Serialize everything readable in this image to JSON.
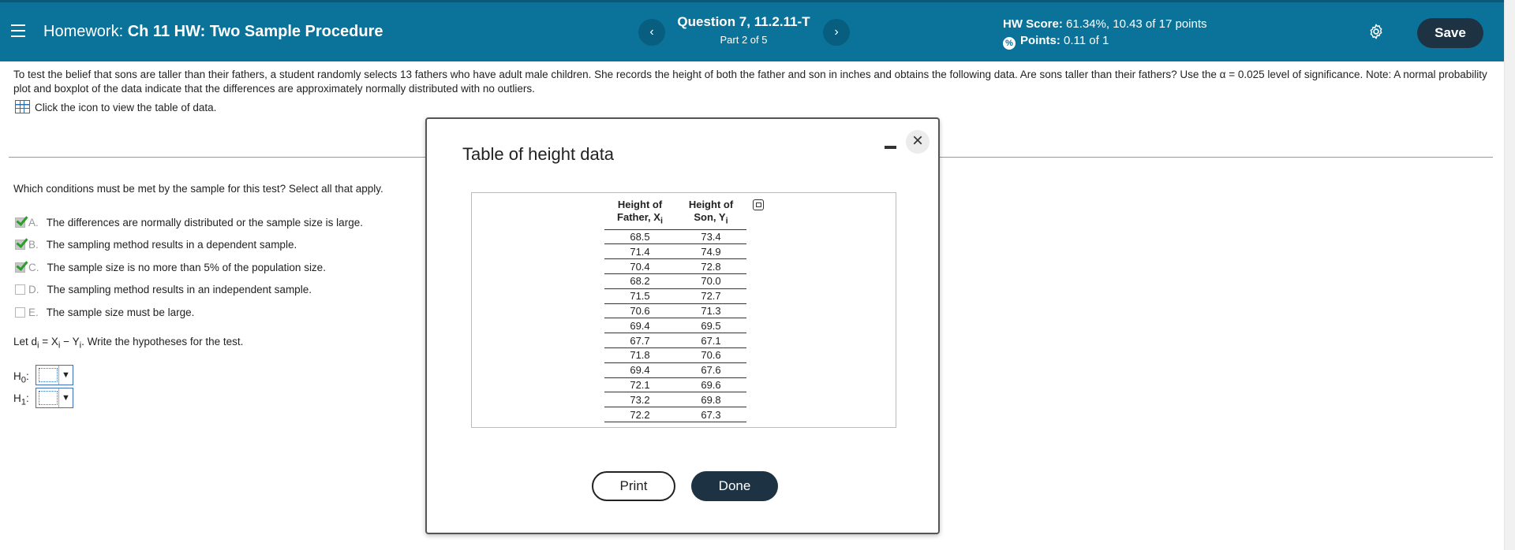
{
  "header": {
    "title_prefix": "Homework:",
    "title": "Ch 11 HW: Two Sample Procedure",
    "question_title": "Question 7, 11.2.11-T",
    "question_part": "Part 2 of 5",
    "prev_label": "‹",
    "next_label": "›",
    "hw_score_label": "HW Score:",
    "hw_score_value": "61.34%, 10.43 of 17 points",
    "points_label": "Points:",
    "points_value": "0.11 of 1",
    "save_label": "Save"
  },
  "problem": {
    "text": "To test the belief that sons are taller than their fathers, a student randomly selects 13 fathers who have adult male children. She records the height of both the father and son in inches and obtains the following data. Are sons taller than their fathers? Use the α = 0.025 level of significance. Note: A normal probability plot and boxplot of the data indicate that the differences are approximately normally distributed with no outliers.",
    "table_link": "Click the icon to view the table of data."
  },
  "conditions": {
    "question": "Which conditions must be met by the sample for this test? Select all that apply.",
    "options": [
      {
        "letter": "A.",
        "text": "The differences are normally distributed or the sample size is large.",
        "checked": true
      },
      {
        "letter": "B.",
        "text": "The sampling method results in a dependent sample.",
        "checked": true
      },
      {
        "letter": "C.",
        "text": "The sample size is no more than 5% of the population size.",
        "checked": true
      },
      {
        "letter": "D.",
        "text": "The sampling method results in an independent sample.",
        "checked": false
      },
      {
        "letter": "E.",
        "text": "The sample size must be large.",
        "checked": false
      }
    ]
  },
  "hypotheses": {
    "instruction_pre": "Let d",
    "instruction_sub": "i",
    "instruction_mid": " = X",
    "instruction_sub2": "i",
    "instruction_mid2": " − Y",
    "instruction_sub3": "i",
    "instruction_post": ". Write the hypotheses for the test.",
    "h0_label": "H",
    "h0_sub": "0",
    "h1_label": "H",
    "h1_sub": "1",
    "colon": ":"
  },
  "modal": {
    "title": "Table of height data",
    "close_label": "×",
    "col1_line1": "Height of",
    "col1_line2": "Father, X",
    "col1_sub": "i",
    "col2_line1": "Height of",
    "col2_line2": "Son, Y",
    "col2_sub": "i",
    "rows": [
      [
        "68.5",
        "73.4"
      ],
      [
        "71.4",
        "74.9"
      ],
      [
        "70.4",
        "72.8"
      ],
      [
        "68.2",
        "70.0"
      ],
      [
        "71.5",
        "72.7"
      ],
      [
        "70.6",
        "71.3"
      ],
      [
        "69.4",
        "69.5"
      ],
      [
        "67.7",
        "67.1"
      ],
      [
        "71.8",
        "70.6"
      ],
      [
        "69.4",
        "67.6"
      ],
      [
        "72.1",
        "69.6"
      ],
      [
        "73.2",
        "69.8"
      ],
      [
        "72.2",
        "67.3"
      ]
    ],
    "print_label": "Print",
    "done_label": "Done"
  },
  "colors": {
    "header_bg": "#0b7399",
    "button_dark": "#1d3344",
    "check_green": "#2a9d2a"
  }
}
